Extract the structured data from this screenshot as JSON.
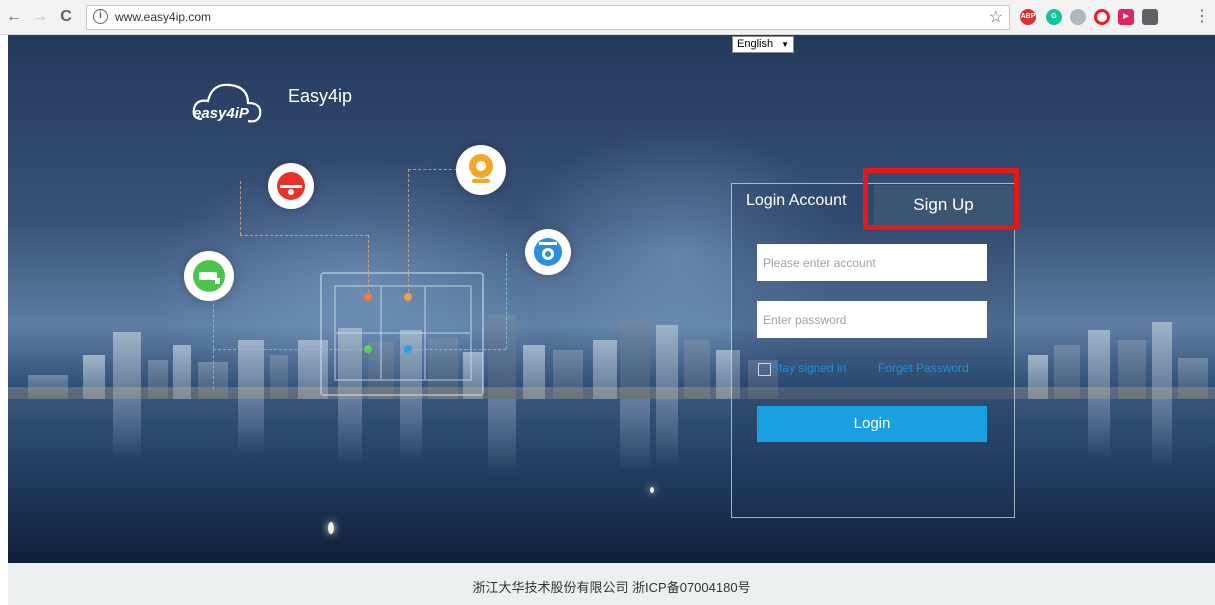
{
  "browser": {
    "url": "www.easy4ip.com",
    "extensions": [
      {
        "name": "adblock-plus-icon",
        "label": "ABP",
        "color": "#d83030"
      },
      {
        "name": "grammarly-icon",
        "label": "G",
        "color": "#15c39a"
      },
      {
        "name": "cloud-icon",
        "label": "",
        "color": "#b0b6bd"
      },
      {
        "name": "opera-icon",
        "label": "",
        "color": "#e81c24"
      },
      {
        "name": "video-icon",
        "label": "",
        "color": "#e0245e"
      },
      {
        "name": "extension-icon",
        "label": "",
        "color": "#5f6368"
      }
    ]
  },
  "header": {
    "logo_text": "easy4iP",
    "brand": "Easy4ip",
    "language": "English"
  },
  "login": {
    "tab_login": "Login Account",
    "tab_signup": "Sign Up",
    "account_placeholder": "Please enter account",
    "password_placeholder": "Enter password",
    "stay_signed_in": "Stay signed in",
    "forget_password": "Forget Password",
    "login_button": "Login"
  },
  "footer": {
    "text": "浙江大华技术股份有限公司 浙ICP备07004180号"
  },
  "colors": {
    "accent": "#1aa0e2",
    "highlight": "#e31a1a",
    "signup_tab": "#3b5573"
  }
}
